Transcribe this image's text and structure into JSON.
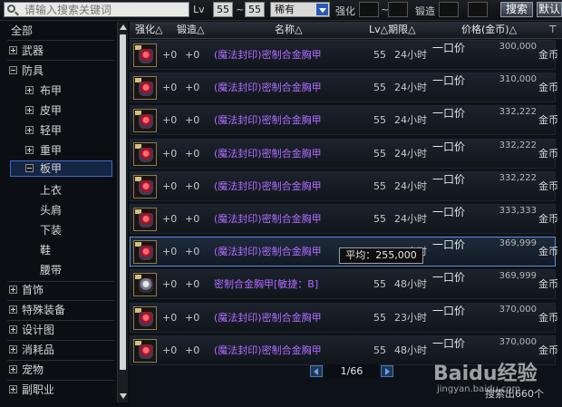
{
  "search": {
    "placeholder": "请输入搜索关键词",
    "level_label": "Lv",
    "level_min": "55",
    "level_sep": "~",
    "level_max": "55",
    "rarity": "稀有",
    "enhance_label": "强化",
    "enhance_sep": "~",
    "forge_label": "锻造",
    "search_button": "搜索",
    "default_button": "默认"
  },
  "sidebar": {
    "all": "全部",
    "weapon": "武器",
    "armor": "防具",
    "cloth": "布甲",
    "leather": "皮甲",
    "light": "轻甲",
    "heavy": "重甲",
    "plate": "板甲",
    "top": "上衣",
    "shoulder": "头肩",
    "bottom": "下装",
    "shoes": "鞋",
    "belt": "腰带",
    "accessory": "首饰",
    "special": "特殊装备",
    "design": "设计图",
    "consumable": "消耗品",
    "pet": "宠物",
    "subjob": "副职业"
  },
  "header": {
    "enhance": "强化△",
    "forge": "锻造△",
    "name": "名称△",
    "level_period": "Lv△期限△",
    "price": "价格(金币)△"
  },
  "rows": [
    {
      "enhance": "+0",
      "forge": "+0",
      "name": "(魔法封印)密制合金胸甲",
      "level": "55",
      "period": "24小时",
      "bid": "一口价",
      "price": "300,000",
      "currency": "金币",
      "alt": false
    },
    {
      "enhance": "+0",
      "forge": "+0",
      "name": "(魔法封印)密制合金胸甲",
      "level": "55",
      "period": "24小时",
      "bid": "一口价",
      "price": "310,000",
      "currency": "金币",
      "alt": false
    },
    {
      "enhance": "+0",
      "forge": "+0",
      "name": "(魔法封印)密制合金胸甲",
      "level": "55",
      "period": "24小时",
      "bid": "一口价",
      "price": "332,222",
      "currency": "金币",
      "alt": false
    },
    {
      "enhance": "+0",
      "forge": "+0",
      "name": "(魔法封印)密制合金胸甲",
      "level": "55",
      "period": "24小时",
      "bid": "一口价",
      "price": "332,222",
      "currency": "金币",
      "alt": false
    },
    {
      "enhance": "+0",
      "forge": "+0",
      "name": "(魔法封印)密制合金胸甲",
      "level": "55",
      "period": "24小时",
      "bid": "一口价",
      "price": "332,222",
      "currency": "金币",
      "alt": false
    },
    {
      "enhance": "+0",
      "forge": "+0",
      "name": "(魔法封印)密制合金胸甲",
      "level": "55",
      "period": "24小时",
      "bid": "一口价",
      "price": "333,333",
      "currency": "金币",
      "alt": false
    },
    {
      "enhance": "+0",
      "forge": "+0",
      "name": "(魔法封印)密制合金胸甲",
      "level": "55",
      "period": "24小时",
      "bid": "一口价",
      "price": "369,999",
      "currency": "金币",
      "alt": false
    },
    {
      "enhance": "+0",
      "forge": "+0",
      "name": "密制合金胸甲[敏捷：B]",
      "level": "55",
      "period": "48小时",
      "bid": "一口价",
      "price": "369,999",
      "currency": "金币",
      "alt": true
    },
    {
      "enhance": "+0",
      "forge": "+0",
      "name": "(魔法封印)密制合金胸甲",
      "level": "55",
      "period": "23小时",
      "bid": "一口价",
      "price": "370,000",
      "currency": "金币",
      "alt": false
    },
    {
      "enhance": "+0",
      "forge": "+0",
      "name": "(魔法封印)密制合金胸甲",
      "level": "55",
      "period": "48小时",
      "bid": "一口价",
      "price": "370,000",
      "currency": "金币",
      "alt": false
    }
  ],
  "tooltip": "平均：255,000",
  "pager": {
    "page": "1/66"
  },
  "result_count": "搜索出660个",
  "watermark": {
    "text": "Baidu经验",
    "sub": "jingyan.baidu.com"
  }
}
